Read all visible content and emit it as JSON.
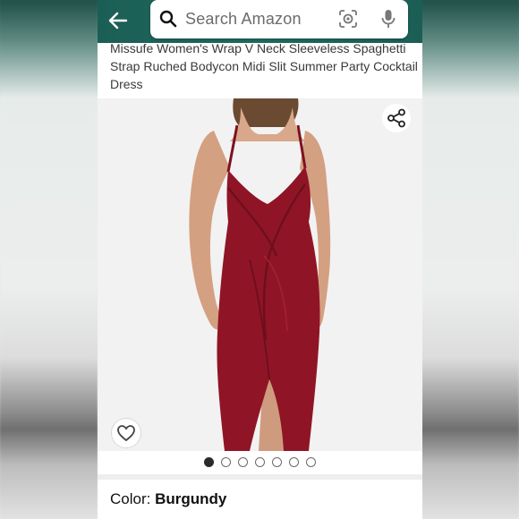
{
  "header": {
    "back_icon": "arrow-left-icon",
    "search": {
      "placeholder": "Search Amazon",
      "lens_icon": "camera-lens-icon",
      "mic_icon": "microphone-icon"
    },
    "color": "#1f6a60"
  },
  "product": {
    "title": "Missufe Women's Wrap V Neck Sleeveless Spaghetti Strap Ruched Bodycon Midi Slit Summer Party Cocktail Dress",
    "image": {
      "share_icon": "share-icon",
      "wishlist_icon": "heart-icon",
      "dress_color": "#8f1526"
    },
    "carousel": {
      "count": 7,
      "active_index": 0
    },
    "color": {
      "label": "Color: ",
      "value": "Burgundy"
    }
  }
}
